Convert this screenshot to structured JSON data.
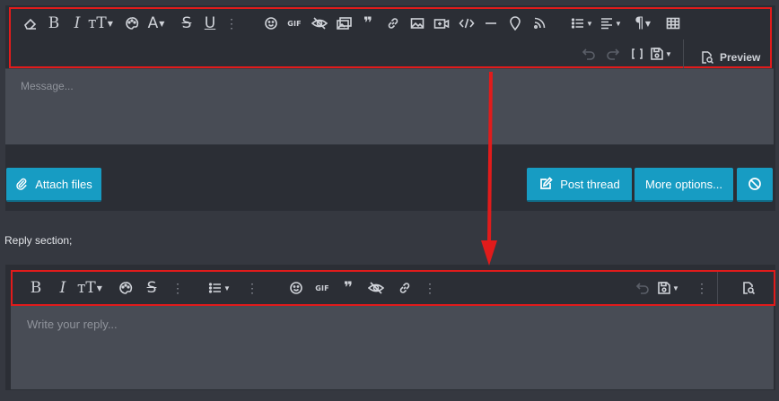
{
  "editor": {
    "message_placeholder": "Message...",
    "preview_label": "Preview",
    "toolbar_icons": [
      "eraser-icon",
      "bold-icon",
      "italic-icon",
      "text-size-icon",
      "palette-icon",
      "font-icon",
      "strikethrough-icon",
      "underline-icon",
      "more-icon",
      "smile-icon",
      "gif-icon",
      "spoiler-icon",
      "media-icon",
      "quote-icon",
      "link-icon",
      "image-icon",
      "video-icon",
      "code-icon",
      "hr-icon",
      "map-pin-icon",
      "rss-icon",
      "list-icon",
      "align-icon",
      "paragraph-icon",
      "table-icon",
      "undo-icon",
      "redo-icon",
      "brackets-icon",
      "drafts-icon",
      "preview-icon"
    ],
    "gif_label": "GIF"
  },
  "actions": {
    "attach_files": "Attach files",
    "post_thread": "Post thread",
    "more_options": "More options..."
  },
  "reply": {
    "section_label": "Reply section;",
    "placeholder": "Write your reply...",
    "gif_label": "GIF",
    "toolbar_icons": [
      "bold-icon",
      "italic-icon",
      "text-size-icon",
      "palette-icon",
      "strikethrough-icon",
      "more-icon",
      "list-icon",
      "more-icon",
      "smile-icon",
      "gif-icon",
      "quote-icon",
      "spoiler-icon",
      "link-icon",
      "more-icon",
      "undo-icon",
      "drafts-icon",
      "more-icon",
      "preview-icon"
    ]
  },
  "colors": {
    "accent": "#179cc3",
    "highlight_border": "#e11b1b",
    "editor_bg": "#2b2e35",
    "input_bg": "#484c55",
    "page_bg": "#353840"
  }
}
